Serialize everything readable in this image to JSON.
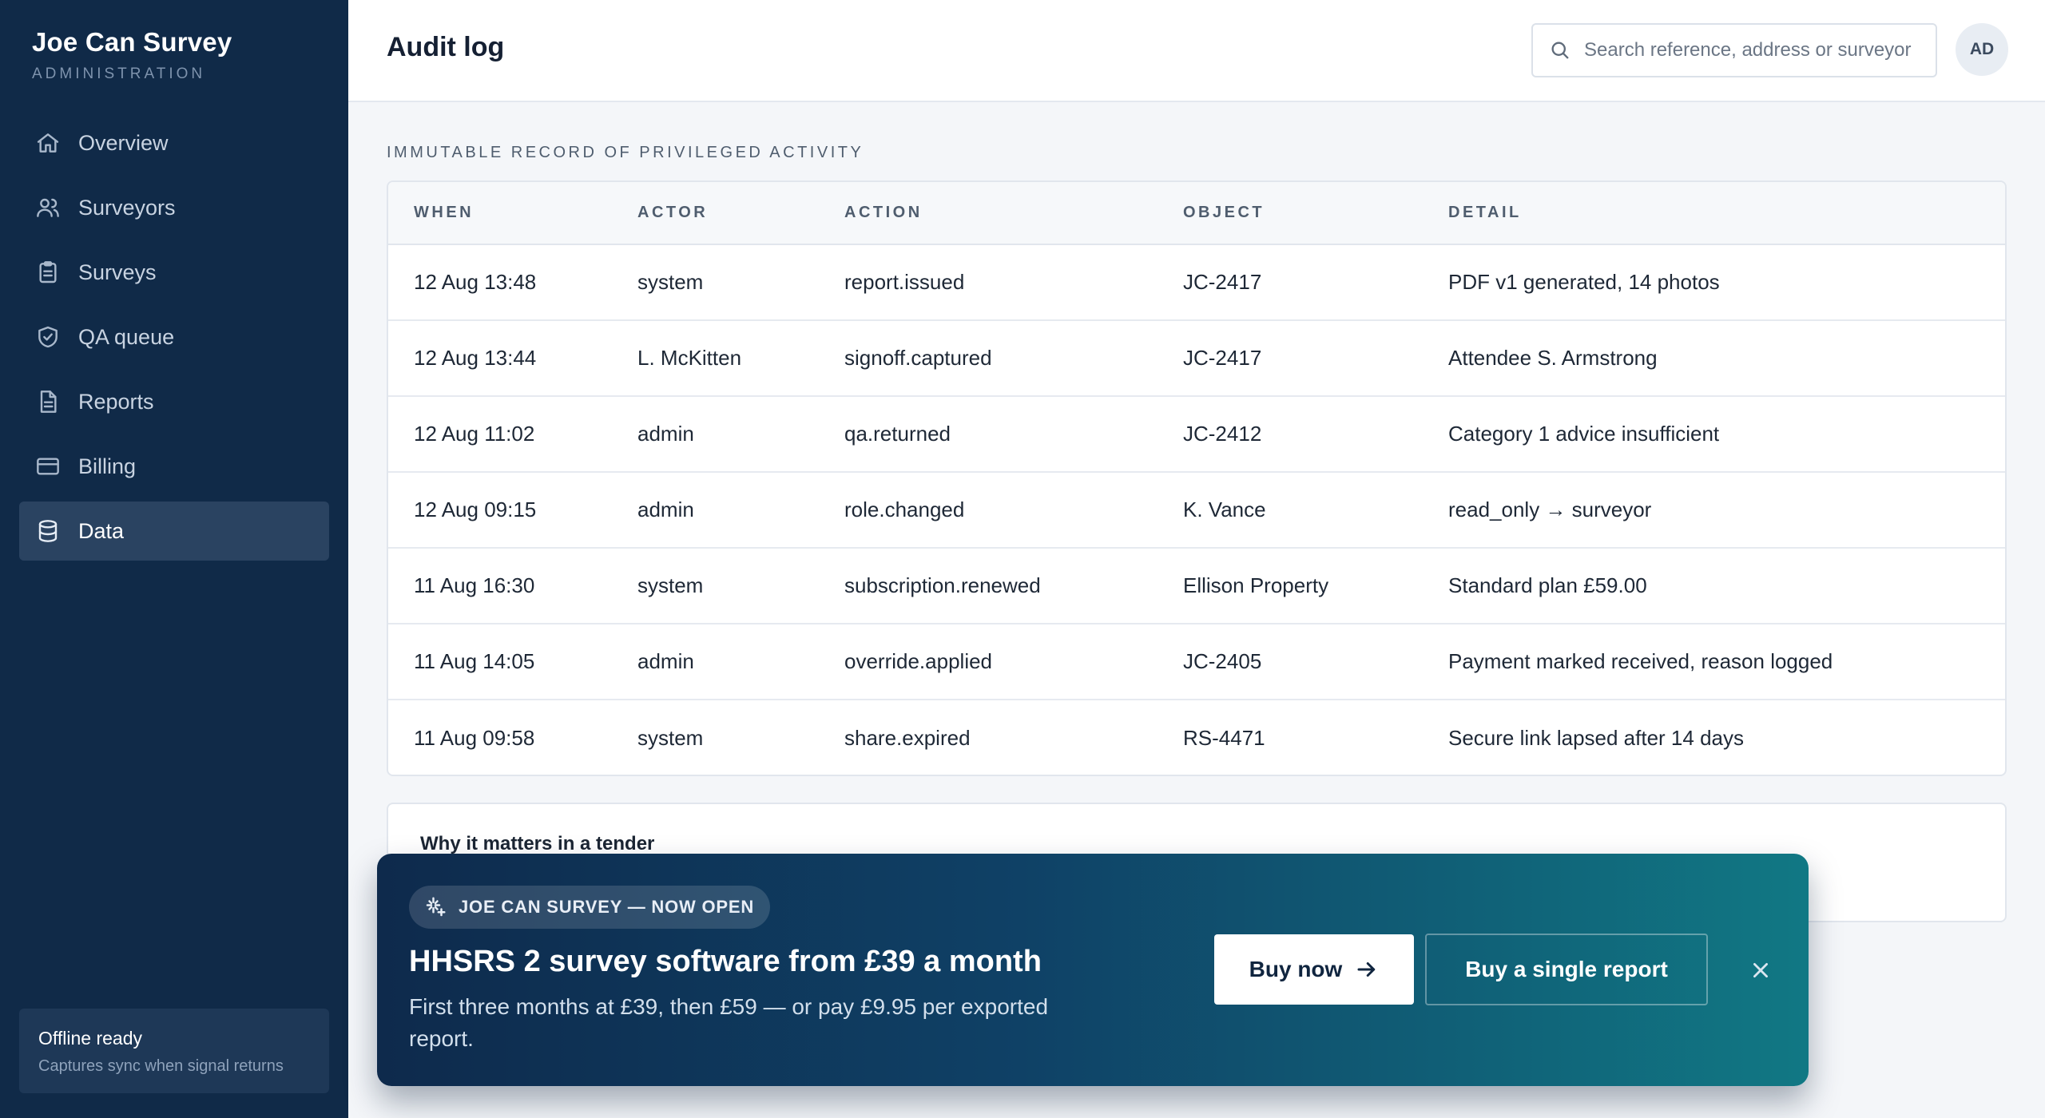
{
  "app": {
    "name": "Joe Can Survey",
    "subtitle": "ADMINISTRATION"
  },
  "sidebar": {
    "items": [
      {
        "label": "Overview",
        "icon": "home-icon",
        "active": false
      },
      {
        "label": "Surveyors",
        "icon": "users-icon",
        "active": false
      },
      {
        "label": "Surveys",
        "icon": "clipboard-icon",
        "active": false
      },
      {
        "label": "QA queue",
        "icon": "shield-check-icon",
        "active": false
      },
      {
        "label": "Reports",
        "icon": "document-icon",
        "active": false
      },
      {
        "label": "Billing",
        "icon": "credit-card-icon",
        "active": false
      },
      {
        "label": "Data",
        "icon": "database-icon",
        "active": true
      }
    ],
    "offline": {
      "title": "Offline ready",
      "subtitle": "Captures sync when signal returns"
    }
  },
  "header": {
    "title": "Audit log",
    "search_placeholder": "Search reference, address or surveyor",
    "avatar_initials": "AD"
  },
  "audit": {
    "section_label": "IMMUTABLE RECORD OF PRIVILEGED ACTIVITY",
    "columns": [
      "WHEN",
      "ACTOR",
      "ACTION",
      "OBJECT",
      "DETAIL"
    ],
    "rows": [
      [
        "12 Aug 13:48",
        "system",
        "report.issued",
        "JC-2417",
        "PDF v1 generated, 14 photos"
      ],
      [
        "12 Aug 13:44",
        "L. McKitten",
        "signoff.captured",
        "JC-2417",
        "Attendee S. Armstrong"
      ],
      [
        "12 Aug 11:02",
        "admin",
        "qa.returned",
        "JC-2412",
        "Category 1 advice insufficient"
      ],
      [
        "12 Aug 09:15",
        "admin",
        "role.changed",
        "K. Vance",
        "read_only → surveyor"
      ],
      [
        "11 Aug 16:30",
        "system",
        "subscription.renewed",
        "Ellison Property",
        "Standard plan £59.00"
      ],
      [
        "11 Aug 14:05",
        "admin",
        "override.applied",
        "JC-2405",
        "Payment marked received, reason logged"
      ],
      [
        "11 Aug 09:58",
        "system",
        "share.expired",
        "RS-4471",
        "Secure link lapsed after 14 days"
      ]
    ]
  },
  "why_card": {
    "title": "Why it matters in a tender"
  },
  "promo": {
    "badge": "JOE CAN SURVEY — NOW OPEN",
    "title": "HHSRS 2 survey software from £39 a month",
    "subtitle": "First three months at £39, then £59 — or pay £9.95 per exported report.",
    "buy_label": "Buy now",
    "single_label": "Buy a single report"
  }
}
